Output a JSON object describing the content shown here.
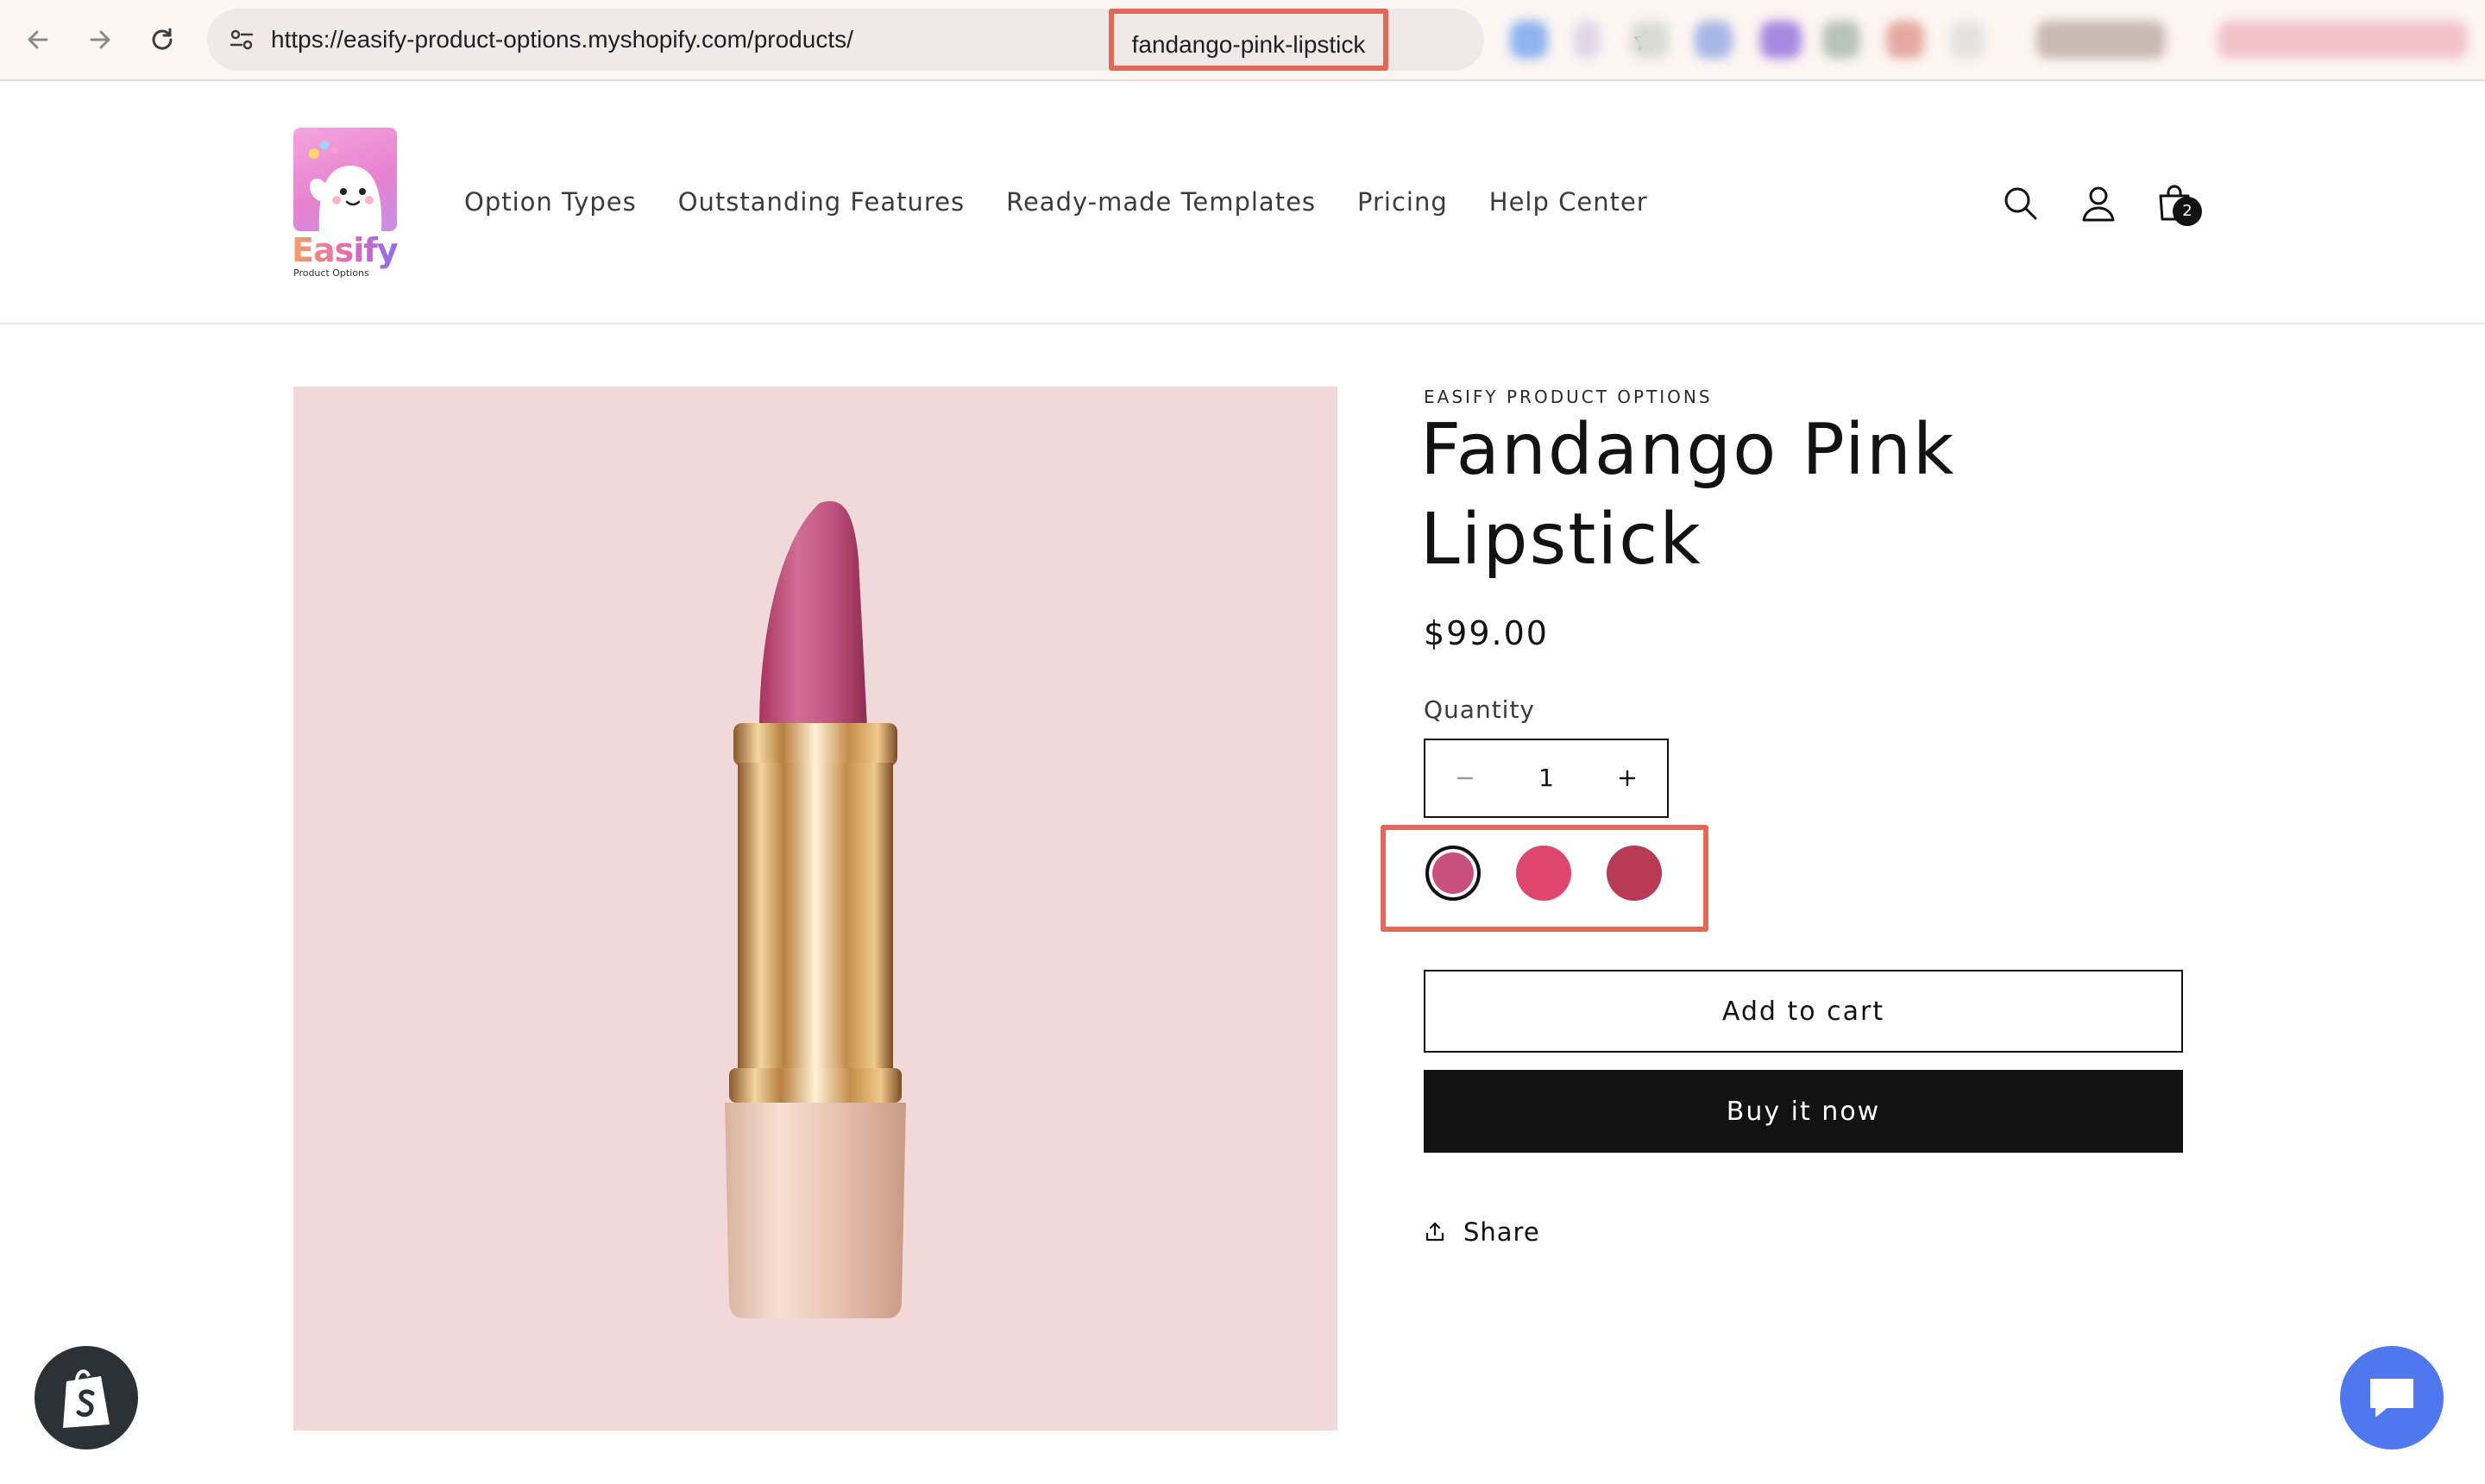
{
  "browser": {
    "url_base": "https://easify-product-options.myshopify.com/products/",
    "url_path": "fandango-pink-lipstick",
    "icons": {
      "back": "back-arrow-icon",
      "forward": "forward-arrow-icon",
      "reload": "reload-icon",
      "site_info": "site-info-icon",
      "bookmark": "star-icon"
    }
  },
  "header": {
    "logo": {
      "word": "Easify",
      "sub": "Product Options"
    },
    "nav": [
      "Option Types",
      "Outstanding Features",
      "Ready-made Templates",
      "Pricing",
      "Help Center"
    ],
    "cart_count": "2",
    "icons": {
      "search": "search-icon",
      "account": "account-icon",
      "cart": "cart-icon"
    }
  },
  "product": {
    "vendor": "EASIFY PRODUCT OPTIONS",
    "title": "Fandango Pink Lipstick",
    "price": "$99.00",
    "quantity_label": "Quantity",
    "quantity": "1",
    "swatches": [
      {
        "color": "#c9507c",
        "selected": true
      },
      {
        "color": "#e0476e",
        "selected": false
      },
      {
        "color": "#b83a55",
        "selected": false
      }
    ],
    "add_to_cart": "Add to cart",
    "buy_now": "Buy it now",
    "share": "Share"
  },
  "theme": {
    "accent_highlight": "#e06a57",
    "image_bg": "#f2d9d9",
    "chat_button": "#4f78ef",
    "button_dark": "#121212"
  }
}
